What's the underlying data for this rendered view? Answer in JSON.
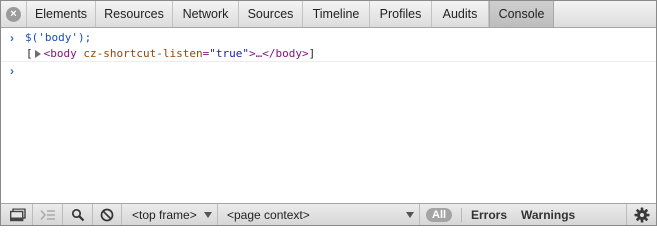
{
  "tabs": [
    {
      "label": "Elements",
      "selected": false
    },
    {
      "label": "Resources",
      "selected": false
    },
    {
      "label": "Network",
      "selected": false
    },
    {
      "label": "Sources",
      "selected": false
    },
    {
      "label": "Timeline",
      "selected": false
    },
    {
      "label": "Profiles",
      "selected": false
    },
    {
      "label": "Audits",
      "selected": false
    },
    {
      "label": "Console",
      "selected": true
    }
  ],
  "close_glyph": "×",
  "console": {
    "prompt_glyph": "›",
    "command": "$('body');",
    "result": {
      "open_bracket": "[",
      "tag_open": "<body",
      "attr_name": "cz-shortcut-listen",
      "attr_eq": "=",
      "attr_value": "\"true\"",
      "tag_close": ">…</body>",
      "close_bracket": "]"
    }
  },
  "statusbar": {
    "icons": [
      "dock-icon",
      "execution-context-icon",
      "search-icon",
      "clear-console-icon"
    ],
    "frame_select": "<top frame>",
    "context_select": "<page context>",
    "filter_all": "All",
    "filter_errors": "Errors",
    "filter_warnings": "Warnings",
    "settings_icon": "gear-icon"
  },
  "colors": {
    "prompt": "#2a6fd6",
    "tag": "#881280",
    "attr": "#994500",
    "value": "#1a1aa6",
    "selected_tab": "#c6c6c6"
  }
}
